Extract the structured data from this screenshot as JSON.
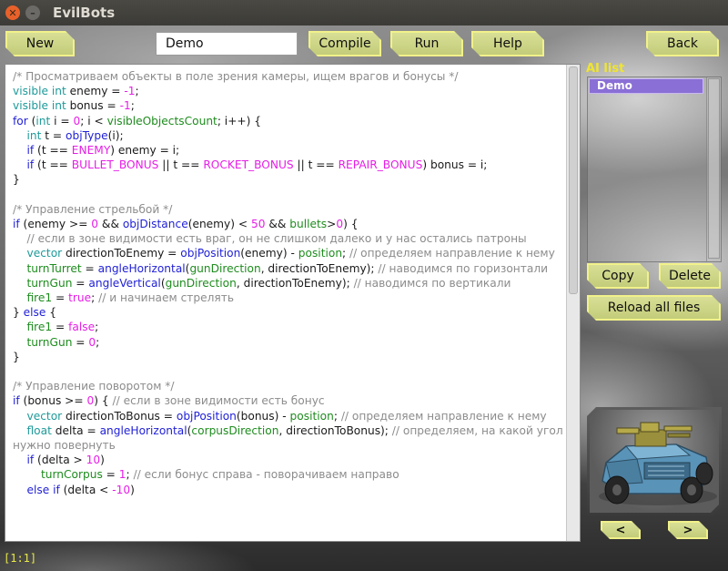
{
  "window": {
    "title": "EvilBots"
  },
  "toolbar": {
    "new_label": "New",
    "name_value": "Demo",
    "compile_label": "Compile",
    "run_label": "Run",
    "help_label": "Help",
    "back_label": "Back"
  },
  "ai_panel": {
    "title": "AI list",
    "items": [
      "Demo"
    ],
    "copy_label": "Copy",
    "delete_label": "Delete",
    "reload_label": "Reload all files",
    "prev_label": "<",
    "next_label": ">"
  },
  "status": {
    "cursor": "[1:1]"
  },
  "colors": {
    "button_fill": "#c9d184",
    "button_border": "#f1f18a",
    "label_yellow": "#f0e52e",
    "selected_item": "#8a6fd6",
    "keyword": "#1f1fd6",
    "type": "#1f9a9a",
    "number": "#e61ee6",
    "variable": "#1e8c1e",
    "comment": "#8c8c8c"
  },
  "icons": {
    "close": "close-icon",
    "minimize": "minimize-icon",
    "preview": "combat-vehicle-image"
  },
  "code_lines": [
    [
      [
        "c",
        "/* Просматриваем объекты в поле зрения камеры, ищем врагов и бонусы */"
      ]
    ],
    [
      [
        "t",
        "visible"
      ],
      [
        "p",
        " "
      ],
      [
        "t",
        "int"
      ],
      [
        "p",
        " enemy = "
      ],
      [
        "n",
        "-1"
      ],
      [
        "p",
        ";"
      ]
    ],
    [
      [
        "t",
        "visible"
      ],
      [
        "p",
        " "
      ],
      [
        "t",
        "int"
      ],
      [
        "p",
        " bonus = "
      ],
      [
        "n",
        "-1"
      ],
      [
        "p",
        ";"
      ]
    ],
    [
      [
        "k",
        "for"
      ],
      [
        "p",
        " ("
      ],
      [
        "t",
        "int"
      ],
      [
        "p",
        " i = "
      ],
      [
        "n",
        "0"
      ],
      [
        "p",
        "; i < "
      ],
      [
        "v",
        "visibleObjectsCount"
      ],
      [
        "p",
        "; i++) {"
      ]
    ],
    [
      [
        "p",
        "    "
      ],
      [
        "t",
        "int"
      ],
      [
        "p",
        " t = "
      ],
      [
        "f",
        "objType"
      ],
      [
        "p",
        "(i);"
      ]
    ],
    [
      [
        "p",
        "    "
      ],
      [
        "k",
        "if"
      ],
      [
        "p",
        " (t == "
      ],
      [
        "n",
        "ENEMY"
      ],
      [
        "p",
        ") enemy = i;"
      ]
    ],
    [
      [
        "p",
        "    "
      ],
      [
        "k",
        "if"
      ],
      [
        "p",
        " (t == "
      ],
      [
        "n",
        "BULLET_BONUS"
      ],
      [
        "p",
        " || t == "
      ],
      [
        "n",
        "ROCKET_BONUS"
      ],
      [
        "p",
        " || t == "
      ],
      [
        "n",
        "REPAIR_BONUS"
      ],
      [
        "p",
        ") bonus = i;"
      ]
    ],
    [
      [
        "p",
        "}"
      ]
    ],
    [
      [
        "p",
        ""
      ]
    ],
    [
      [
        "c",
        "/* Управление стрельбой */"
      ]
    ],
    [
      [
        "k",
        "if"
      ],
      [
        "p",
        " (enemy >= "
      ],
      [
        "n",
        "0"
      ],
      [
        "p",
        " && "
      ],
      [
        "f",
        "objDistance"
      ],
      [
        "p",
        "(enemy) < "
      ],
      [
        "n",
        "50"
      ],
      [
        "p",
        " && "
      ],
      [
        "v",
        "bullets"
      ],
      [
        "p",
        ">"
      ],
      [
        "n",
        "0"
      ],
      [
        "p",
        ") {"
      ]
    ],
    [
      [
        "p",
        "    "
      ],
      [
        "c",
        "// если в зоне видимости есть враг, он не слишком далеко и у нас остались патроны"
      ]
    ],
    [
      [
        "p",
        "    "
      ],
      [
        "t",
        "vector"
      ],
      [
        "p",
        " directionToEnemy = "
      ],
      [
        "f",
        "objPosition"
      ],
      [
        "p",
        "(enemy) - "
      ],
      [
        "v",
        "position"
      ],
      [
        "p",
        "; "
      ],
      [
        "c",
        "// определяем направление к немy"
      ]
    ],
    [
      [
        "p",
        "    "
      ],
      [
        "v",
        "turnTurret"
      ],
      [
        "p",
        " = "
      ],
      [
        "f",
        "angleHorizontal"
      ],
      [
        "p",
        "("
      ],
      [
        "v",
        "gunDirection"
      ],
      [
        "p",
        ", directionToEnemy); "
      ],
      [
        "c",
        "// наводимся по горизонтали"
      ]
    ],
    [
      [
        "p",
        "    "
      ],
      [
        "v",
        "turnGun"
      ],
      [
        "p",
        " = "
      ],
      [
        "f",
        "angleVertical"
      ],
      [
        "p",
        "("
      ],
      [
        "v",
        "gunDirection"
      ],
      [
        "p",
        ", directionToEnemy); "
      ],
      [
        "c",
        "// наводимся по вертикали"
      ]
    ],
    [
      [
        "p",
        "    "
      ],
      [
        "v",
        "fire1"
      ],
      [
        "p",
        " = "
      ],
      [
        "n",
        "true"
      ],
      [
        "p",
        "; "
      ],
      [
        "c",
        "// и начинаем стрелять"
      ]
    ],
    [
      [
        "p",
        "} "
      ],
      [
        "k",
        "else"
      ],
      [
        "p",
        " {"
      ]
    ],
    [
      [
        "p",
        "    "
      ],
      [
        "v",
        "fire1"
      ],
      [
        "p",
        " = "
      ],
      [
        "n",
        "false"
      ],
      [
        "p",
        ";"
      ]
    ],
    [
      [
        "p",
        "    "
      ],
      [
        "v",
        "turnGun"
      ],
      [
        "p",
        " = "
      ],
      [
        "n",
        "0"
      ],
      [
        "p",
        ";"
      ]
    ],
    [
      [
        "p",
        "}"
      ]
    ],
    [
      [
        "p",
        ""
      ]
    ],
    [
      [
        "c",
        "/* Управление поворотом */"
      ]
    ],
    [
      [
        "k",
        "if"
      ],
      [
        "p",
        " (bonus >= "
      ],
      [
        "n",
        "0"
      ],
      [
        "p",
        ") { "
      ],
      [
        "c",
        "// если в зоне видимости есть бонус"
      ]
    ],
    [
      [
        "p",
        "    "
      ],
      [
        "t",
        "vector"
      ],
      [
        "p",
        " directionToBonus = "
      ],
      [
        "f",
        "objPosition"
      ],
      [
        "p",
        "(bonus) - "
      ],
      [
        "v",
        "position"
      ],
      [
        "p",
        "; "
      ],
      [
        "c",
        "// определяем направление к немy"
      ]
    ],
    [
      [
        "p",
        "    "
      ],
      [
        "t",
        "float"
      ],
      [
        "p",
        " delta = "
      ],
      [
        "f",
        "angleHorizontal"
      ],
      [
        "p",
        "("
      ],
      [
        "v",
        "corpusDirection"
      ],
      [
        "p",
        ", directionToBonus); "
      ],
      [
        "c",
        "// определяем, на какой угол нужно повернуть"
      ]
    ],
    [
      [
        "p",
        "    "
      ],
      [
        "k",
        "if"
      ],
      [
        "p",
        " (delta > "
      ],
      [
        "n",
        "10"
      ],
      [
        "p",
        ")"
      ]
    ],
    [
      [
        "p",
        "        "
      ],
      [
        "v",
        "turnCorpus"
      ],
      [
        "p",
        " = "
      ],
      [
        "n",
        "1"
      ],
      [
        "p",
        "; "
      ],
      [
        "c",
        "// если бонус справа - поворачиваем направо"
      ]
    ],
    [
      [
        "p",
        "    "
      ],
      [
        "k",
        "else if"
      ],
      [
        "p",
        " (delta < "
      ],
      [
        "n",
        "-10"
      ],
      [
        "p",
        ")"
      ]
    ]
  ]
}
